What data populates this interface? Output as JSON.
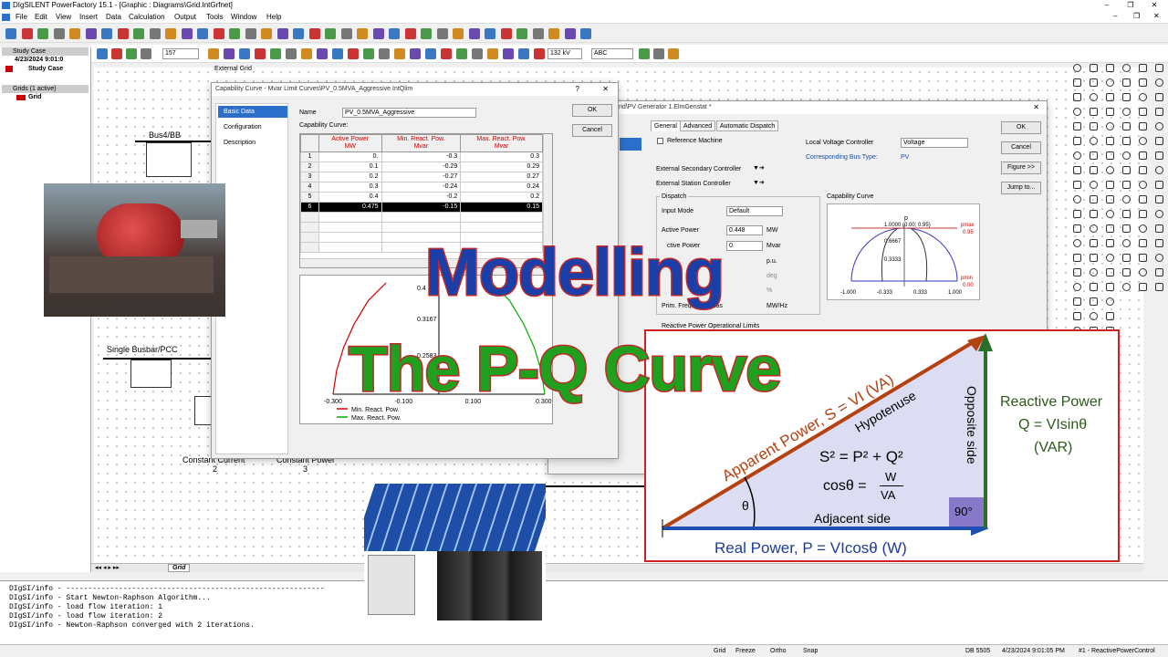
{
  "app": {
    "title": "DIgSILENT PowerFactory 15.1 - [Graphic : Diagrams\\Grid.IntGrfnet]",
    "menu": [
      "File",
      "Edit",
      "View",
      "Insert",
      "Data",
      "Calculation",
      "Output",
      "Tools",
      "Window",
      "Help"
    ],
    "zoom": "157",
    "voltage": "132 kV",
    "abc": "ABC"
  },
  "tree": {
    "study_header": "Study Case",
    "study_date": "4/23/2024 9:01:0",
    "study_case": "Study Case",
    "grids_header": "Grids (1 active)",
    "grid": "Grid"
  },
  "diagram": {
    "external_grid": "External Grid",
    "bus4": "Bus4/BB",
    "single_busbar": "Single Busbar/PCC",
    "constant_current": "Constant Current",
    "constant_current_num": "2",
    "constant_power": "Constant Power",
    "constant_power_num": "3",
    "page_tab": "Grid"
  },
  "cap_dialog": {
    "title": "Capability Curve - Mvar Limit Curves\\PV_0.5MVA_Aggressive.IntQlim",
    "nav": [
      "Basic Data",
      "Configuration",
      "Description"
    ],
    "name_label": "Name",
    "name_value": "PV_0.5MVA_Aggressive",
    "curve_label": "Capability Curve:",
    "ok": "OK",
    "cancel": "Cancel",
    "help": "?",
    "close": "✕",
    "columns": [
      {
        "title": "Active Power",
        "unit": "MW"
      },
      {
        "title": "Min. React. Pow.",
        "unit": "Mvar"
      },
      {
        "title": "Max. React. Pow.",
        "unit": "Mvar"
      }
    ],
    "rows": [
      [
        "1",
        "0.",
        "-0.3",
        "0.3"
      ],
      [
        "2",
        "0.1",
        "-0.29",
        "0.29"
      ],
      [
        "3",
        "0.2",
        "-0.27",
        "0.27"
      ],
      [
        "4",
        "0.3",
        "-0.24",
        "0.24"
      ],
      [
        "5",
        "0.4",
        "-0.2",
        "0.2"
      ],
      [
        "6",
        "0.475",
        "-0.15",
        "0.15"
      ]
    ],
    "legend_min": "Min. React. Pow.",
    "legend_max": "Max. React. Pow."
  },
  "gen_dialog": {
    "title": "rid\\PV Generator 1.ElmGenstat *",
    "tabs": [
      "General",
      "Advanced",
      "Automatic Dispatch"
    ],
    "ref_machine": "Reference Machine",
    "local_vc_label": "Local Voltage Controller",
    "local_vc_value": "Voltage",
    "bus_type_label": "Corresponding Bus Type:",
    "bus_type_value": "PV",
    "ext_sec": "External Secondary Controller",
    "ext_station": "External Station Controller",
    "dispatch": "Dispatch",
    "input_mode_label": "Input Mode",
    "input_mode_value": "Default",
    "active_power_label": "Active Power",
    "active_power_value": "0.448",
    "active_power_unit": "MW",
    "reactive_power_label": "ctive Power",
    "reactive_power_value": "0.",
    "reactive_power_unit": "Mvar",
    "pu": "p.u.",
    "deg": "deg",
    "pct": "%",
    "ge": "ge",
    "prim_freq": "Prim. Frequency Bias",
    "prim_freq_unit": "MW/Hz",
    "react_limits": "Reactive Power Operational Limits",
    "cap_curve_label": "Capability Curve",
    "ok": "OK",
    "cancel": "Cancel",
    "figure": "Figure >>",
    "jump": "Jump to...",
    "close": "✕",
    "mini_chart": {
      "p_label": "p",
      "top_label": "1.0000 (0.00; 0.95)",
      "mid1": "0.6667",
      "mid2": "0.3333",
      "pmax": "pmax",
      "pmax_val": "0.95",
      "pmin": "pmin",
      "pmin_val": "0.00",
      "x_ticks": [
        "-1.000",
        "-0.333",
        "0.333",
        "1.000"
      ]
    }
  },
  "overlay": {
    "line1": "Modelling",
    "line2": "The P-Q Curve",
    "apparent": "Apparent Power, S = VI (VA)",
    "hypotenuse": "Hypotenuse",
    "opposite": "Opposite side",
    "adjacent": "Adjacent side",
    "theta": "θ",
    "right_angle": "90°",
    "eq1": "S² = P² + Q²",
    "eq2_left": "cosθ =",
    "eq2_num": "W",
    "eq2_den": "VA",
    "real": "Real Power, P = VIcosθ (W)",
    "reactive_title": "Reactive Power",
    "reactive_eq": "Q = VIsinθ",
    "reactive_unit": "(VAR)"
  },
  "console": [
    "DIgSI/info - -----------------------------------------------------------",
    "DIgSI/info - Start Newton-Raphson Algorithm...",
    "DIgSI/info - load flow iteration: 1",
    "DIgSI/info - load flow iteration: 2",
    "DIgSI/info - Newton-Raphson converged with 2 iterations."
  ],
  "status": {
    "grid": "Grid",
    "freeze": "Freeze",
    "ortho": "Ortho",
    "snap": "Snap",
    "db": "DB 5505",
    "datetime": "4/23/2024 9:01:05 PM",
    "active": "#1 - ReactivePowerControl"
  },
  "chart_data": {
    "type": "line",
    "x_ticks": [
      "-0.300",
      "-0.100",
      "0.100",
      "0.300"
    ],
    "y_ticks": [
      "0.4",
      "0.3167",
      "0.2583"
    ],
    "series": [
      {
        "name": "Min. React. Pow.",
        "color": "#d00000",
        "x": [
          -0.3,
          -0.29,
          -0.27,
          -0.24,
          -0.2,
          -0.15
        ],
        "y": [
          0,
          0.1,
          0.2,
          0.3,
          0.4,
          0.475
        ]
      },
      {
        "name": "Max. React. Pow.",
        "color": "#00b000",
        "x": [
          0.3,
          0.29,
          0.27,
          0.24,
          0.2,
          0.15
        ],
        "y": [
          0,
          0.1,
          0.2,
          0.3,
          0.4,
          0.475
        ]
      }
    ],
    "xlim": [
      -0.3,
      0.3
    ],
    "ylim": [
      0,
      0.475
    ]
  }
}
